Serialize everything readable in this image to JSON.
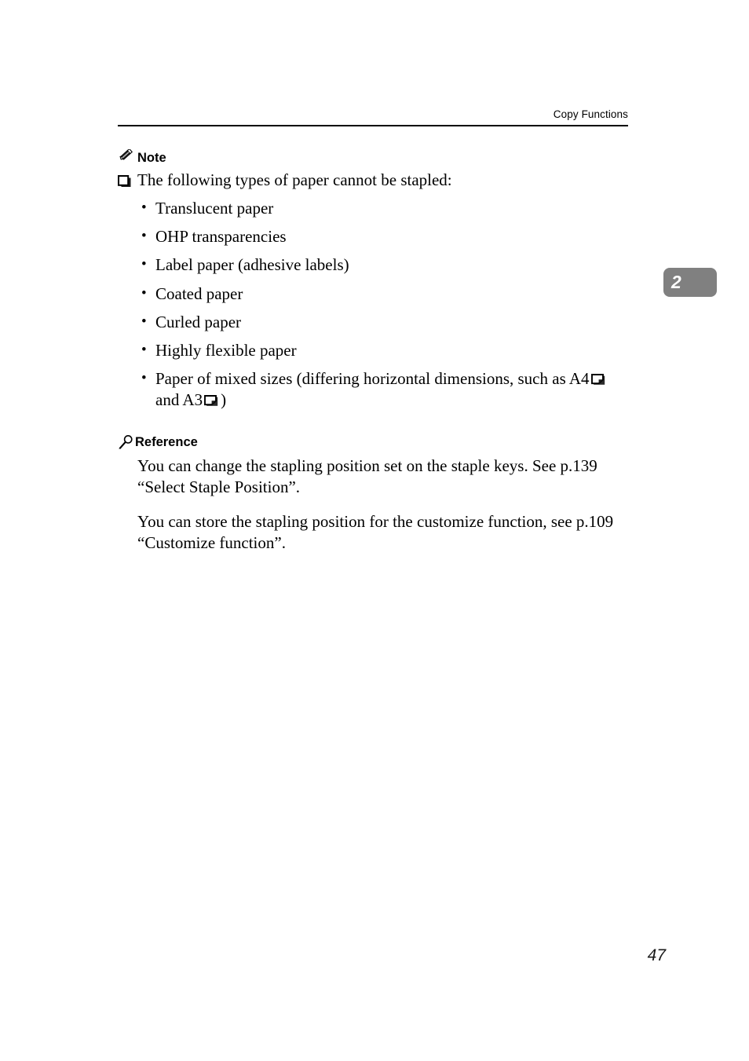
{
  "header": {
    "running_title": "Copy Functions"
  },
  "chapter_tab": {
    "number": "2",
    "color": "#808080",
    "text_color": "#ffffff"
  },
  "note_section": {
    "icon": "pencil-icon",
    "heading": "Note",
    "item_icon": "checkbox-square-icon",
    "item_text": "The following types of paper cannot be stapled:",
    "bullet_glyph": "•",
    "bullets": [
      {
        "text": "Translucent paper"
      },
      {
        "text": "OHP transparencies"
      },
      {
        "text": "Label paper (adhesive labels)"
      },
      {
        "text": "Coated paper"
      },
      {
        "text": "Curled paper"
      },
      {
        "text": "Highly flexible paper"
      }
    ],
    "mixed_sizes": {
      "lead_text": "Paper of mixed sizes (differing horizontal dimensions, such as A4",
      "icon_1": "paper-landscape-icon",
      "middle_text": "and",
      "size_2": "A3",
      "icon_2": "paper-landscape-icon",
      "tail_text": ")"
    }
  },
  "reference_section": {
    "icon": "magnifier-icon",
    "heading": "Reference",
    "paragraphs": [
      "You can change the stapling position set on the staple keys. See p.139 “Select Staple Position”.",
      "You can store the stapling position for the customize function, see p.109 “Customize function”."
    ]
  },
  "footer": {
    "page_number": "47"
  }
}
